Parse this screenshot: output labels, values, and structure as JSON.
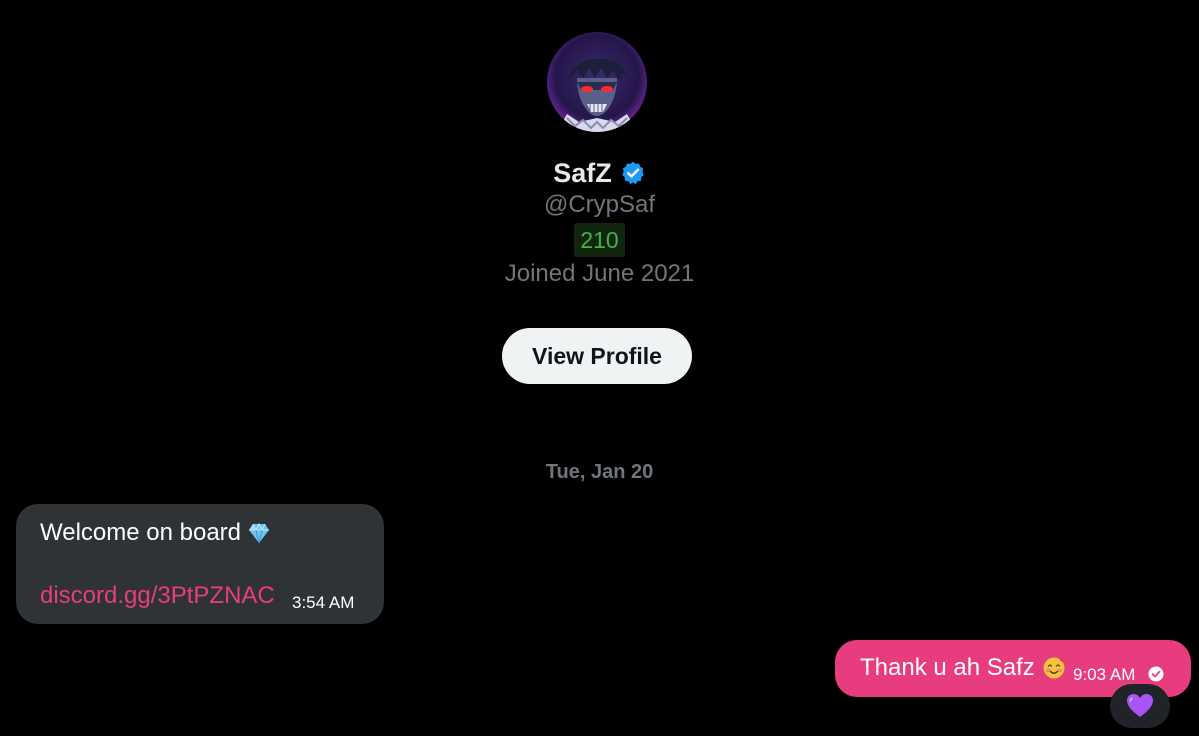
{
  "profile": {
    "display_name": "SafZ",
    "verified_icon": "verified-badge-icon",
    "handle": "@CrypSaf",
    "score": "210",
    "joined": "Joined June 2021",
    "view_profile_label": "View Profile"
  },
  "conversation": {
    "date_separator": "Tue, Jan 20",
    "messages": [
      {
        "direction": "incoming",
        "text": "Welcome on board",
        "emoji_icon": "gem-icon",
        "link": "discord.gg/3PtPZNAC",
        "time": "3:54 AM"
      },
      {
        "direction": "outgoing",
        "text": "Thank u ah Safz",
        "emoji_icon": "smiling-face-with-hearts-icon",
        "time": "9:03 AM",
        "status_icon": "sent-check-icon",
        "reaction_icon": "purple-heart-icon"
      }
    ]
  },
  "colors": {
    "background": "#000000",
    "incoming_bubble": "#2f3336",
    "outgoing_bubble": "#e73d7f",
    "link": "#e73d7f",
    "verified": "#1d9bf0",
    "score_text": "#43b243",
    "score_bg": "#12260f",
    "muted_text": "#71767b",
    "button_bg": "#eff3f4"
  }
}
